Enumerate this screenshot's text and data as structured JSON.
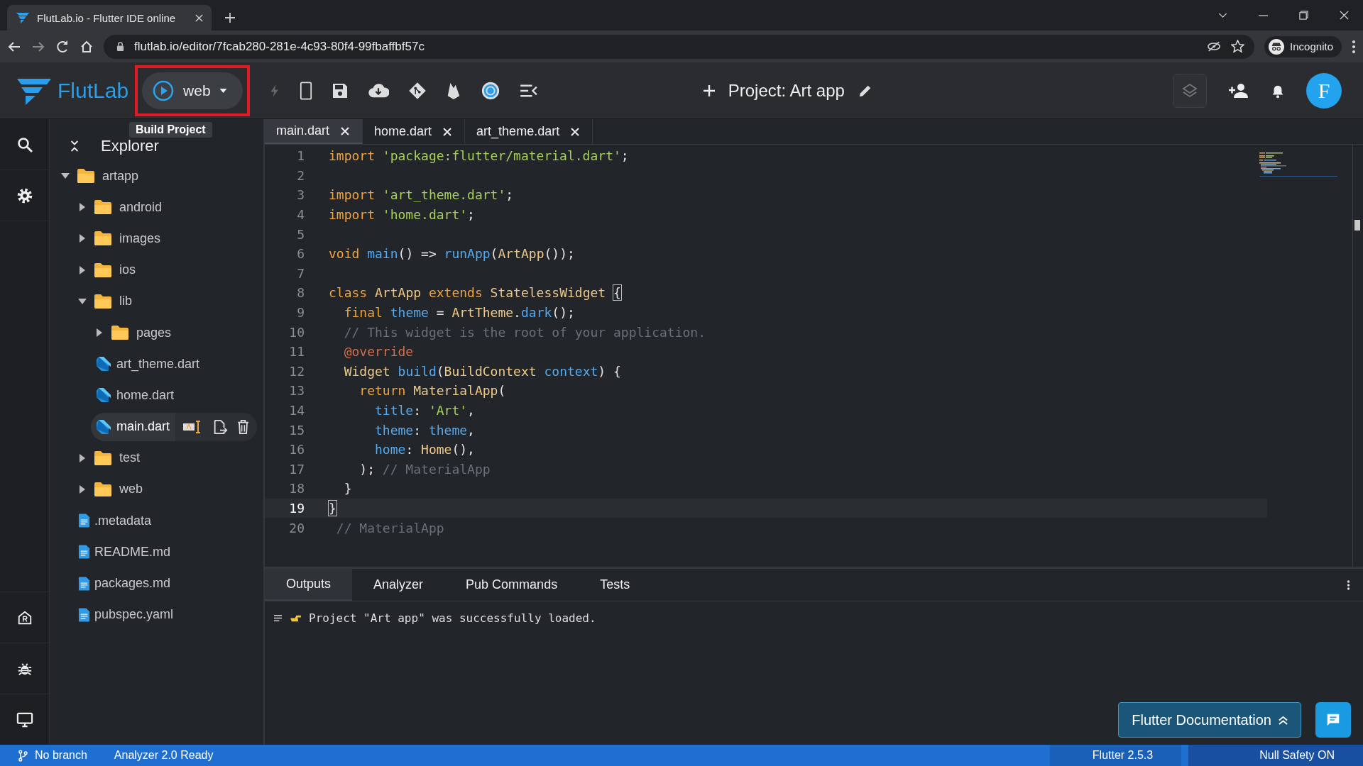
{
  "browser": {
    "tab_title": "FlutLab.io - Flutter IDE online",
    "url": "flutlab.io/editor/7fcab280-281e-4c93-80f4-99fbaffbf57c",
    "profile": "Incognito"
  },
  "toolbar": {
    "logo": "FlutLab",
    "target": "web",
    "run_highlighted": true,
    "tooltip": "Build Project",
    "project": "Project: Art app",
    "avatar": "F"
  },
  "explorer": {
    "title": "Explorer",
    "tree": [
      {
        "name": "artapp",
        "kind": "folder",
        "expanded": true,
        "selected": false,
        "children": [
          {
            "name": "android",
            "kind": "folder",
            "expanded": false,
            "selected": false
          },
          {
            "name": "images",
            "kind": "folder",
            "expanded": false,
            "selected": false
          },
          {
            "name": "ios",
            "kind": "folder",
            "expanded": false,
            "selected": false
          },
          {
            "name": "lib",
            "kind": "folder",
            "expanded": true,
            "selected": false,
            "children": [
              {
                "name": "pages",
                "kind": "folder",
                "expanded": false,
                "selected": false
              },
              {
                "name": "art_theme.dart",
                "kind": "dart",
                "selected": false
              },
              {
                "name": "home.dart",
                "kind": "dart",
                "selected": false
              },
              {
                "name": "main.dart",
                "kind": "dart",
                "selected": true
              }
            ]
          },
          {
            "name": "test",
            "kind": "folder",
            "expanded": false,
            "selected": false
          },
          {
            "name": "web",
            "kind": "folder",
            "expanded": false,
            "selected": false
          },
          {
            "name": ".metadata",
            "kind": "doc",
            "selected": false
          },
          {
            "name": "README.md",
            "kind": "doc",
            "selected": false
          },
          {
            "name": "packages.md",
            "kind": "doc",
            "selected": false
          },
          {
            "name": "pubspec.yaml",
            "kind": "doc",
            "selected": false
          }
        ]
      }
    ]
  },
  "tabs": [
    {
      "label": "main.dart",
      "selected": true
    },
    {
      "label": "home.dart",
      "selected": false
    },
    {
      "label": "art_theme.dart",
      "selected": false
    }
  ],
  "code": [
    {
      "number": "1",
      "selected": false,
      "tokens": [
        {
          "kind": "kw",
          "text": "import "
        },
        {
          "kind": "str",
          "text": "'package:flutter/material.dart'"
        },
        {
          "kind": "plain",
          "text": ";"
        }
      ]
    },
    {
      "number": "2",
      "selected": false
    },
    {
      "number": "3",
      "selected": false,
      "tokens": [
        {
          "kind": "kw",
          "text": "import "
        },
        {
          "kind": "str",
          "text": "'art_theme.dart'"
        },
        {
          "kind": "plain",
          "text": ";"
        }
      ]
    },
    {
      "number": "4",
      "selected": false,
      "tokens": [
        {
          "kind": "kw",
          "text": "import "
        },
        {
          "kind": "str",
          "text": "'home.dart'"
        },
        {
          "kind": "plain",
          "text": ";"
        }
      ]
    },
    {
      "number": "5",
      "selected": false
    },
    {
      "number": "6",
      "selected": false,
      "tokens": [
        {
          "kind": "kw",
          "text": "void "
        },
        {
          "kind": "fn",
          "text": "main"
        },
        {
          "kind": "plain",
          "text": "() => "
        },
        {
          "kind": "fn",
          "text": "runApp"
        },
        {
          "kind": "plain",
          "text": "("
        },
        {
          "kind": "type",
          "text": "ArtApp"
        },
        {
          "kind": "plain",
          "text": "());"
        }
      ]
    },
    {
      "number": "7",
      "selected": false
    },
    {
      "number": "8",
      "selected": false,
      "tokens": [
        {
          "kind": "kw",
          "text": "class "
        },
        {
          "kind": "type",
          "text": "ArtApp "
        },
        {
          "kind": "kw",
          "text": "extends "
        },
        {
          "kind": "type",
          "text": "StatelessWidget "
        },
        {
          "kind": "bracket",
          "text": "{"
        }
      ]
    },
    {
      "number": "9",
      "selected": false,
      "tokens": [
        {
          "kind": "kw",
          "text": "  final "
        },
        {
          "kind": "fn",
          "text": "theme"
        },
        {
          "kind": "plain",
          "text": " = "
        },
        {
          "kind": "type",
          "text": "ArtTheme"
        },
        {
          "kind": "plain",
          "text": "."
        },
        {
          "kind": "fn",
          "text": "dark"
        },
        {
          "kind": "plain",
          "text": "();"
        }
      ]
    },
    {
      "number": "10",
      "selected": false,
      "tokens": [
        {
          "kind": "comment",
          "text": "  // This widget is the root of your application."
        }
      ]
    },
    {
      "number": "11",
      "selected": false,
      "tokens": [
        {
          "kind": "annot",
          "text": "  @override"
        }
      ]
    },
    {
      "number": "12",
      "selected": false,
      "tokens": [
        {
          "kind": "type",
          "text": "  Widget "
        },
        {
          "kind": "fn",
          "text": "build"
        },
        {
          "kind": "plain",
          "text": "("
        },
        {
          "kind": "type",
          "text": "BuildContext "
        },
        {
          "kind": "fn",
          "text": "context"
        },
        {
          "kind": "plain",
          "text": ") {"
        }
      ]
    },
    {
      "number": "13",
      "selected": false,
      "tokens": [
        {
          "kind": "kw",
          "text": "    return "
        },
        {
          "kind": "type",
          "text": "MaterialApp"
        },
        {
          "kind": "plain",
          "text": "("
        }
      ]
    },
    {
      "number": "14",
      "selected": false,
      "tokens": [
        {
          "kind": "fn",
          "text": "      title"
        },
        {
          "kind": "plain",
          "text": ": "
        },
        {
          "kind": "str",
          "text": "'Art'"
        },
        {
          "kind": "plain",
          "text": ","
        }
      ]
    },
    {
      "number": "15",
      "selected": false,
      "tokens": [
        {
          "kind": "fn",
          "text": "      theme"
        },
        {
          "kind": "plain",
          "text": ": "
        },
        {
          "kind": "fn",
          "text": "theme"
        },
        {
          "kind": "plain",
          "text": ","
        }
      ]
    },
    {
      "number": "16",
      "selected": false,
      "tokens": [
        {
          "kind": "fn",
          "text": "      home"
        },
        {
          "kind": "plain",
          "text": ": "
        },
        {
          "kind": "type",
          "text": "Home"
        },
        {
          "kind": "plain",
          "text": "(),"
        }
      ]
    },
    {
      "number": "17",
      "selected": false,
      "tokens": [
        {
          "kind": "plain",
          "text": "    ); "
        },
        {
          "kind": "comment",
          "text": "// MaterialApp"
        }
      ]
    },
    {
      "number": "18",
      "selected": false,
      "tokens": [
        {
          "kind": "plain",
          "text": "  }"
        }
      ]
    },
    {
      "number": "19",
      "selected": true,
      "tokens": [
        {
          "kind": "bracket",
          "text": "}"
        }
      ]
    },
    {
      "number": "20",
      "selected": false,
      "tokens": [
        {
          "kind": "comment",
          "text": " // MaterialApp"
        }
      ]
    }
  ],
  "output_tabs": [
    {
      "label": "Outputs",
      "selected": true
    },
    {
      "label": "Analyzer",
      "selected": false
    },
    {
      "label": "Pub Commands",
      "selected": false
    },
    {
      "label": "Tests",
      "selected": false
    }
  ],
  "log": {
    "message": "Project \"Art app\" was successfully loaded."
  },
  "doc_button": "Flutter Documentation",
  "status": {
    "branch": "No branch",
    "analyzer": "Analyzer 2.0 Ready",
    "flutter": "Flutter 2.5.3",
    "null_safety": "Null Safety ON"
  }
}
